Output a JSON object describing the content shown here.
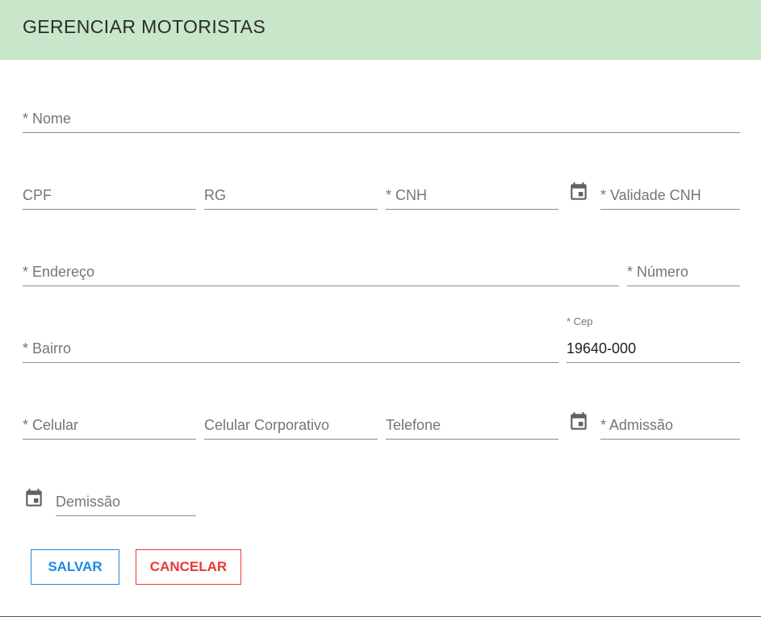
{
  "header": {
    "title": "GERENCIAR MOTORISTAS"
  },
  "form": {
    "nome": {
      "placeholder": "* Nome",
      "value": ""
    },
    "cpf": {
      "placeholder": "CPF",
      "value": ""
    },
    "rg": {
      "placeholder": "RG",
      "value": ""
    },
    "cnh": {
      "placeholder": "* CNH",
      "value": ""
    },
    "validade_cnh": {
      "placeholder": "* Validade CNH",
      "value": "",
      "icon": "calendar-icon"
    },
    "endereco": {
      "placeholder": "* Endereço",
      "value": ""
    },
    "numero": {
      "placeholder": "* Número",
      "value": ""
    },
    "bairro": {
      "placeholder": "* Bairro",
      "value": ""
    },
    "cep": {
      "label": "* Cep",
      "value": "19640-000"
    },
    "celular": {
      "placeholder": "* Celular",
      "value": ""
    },
    "celular_corporativo": {
      "placeholder": "Celular Corporativo",
      "value": ""
    },
    "telefone": {
      "placeholder": "Telefone",
      "value": ""
    },
    "admissao": {
      "placeholder": "* Admissão",
      "value": "",
      "icon": "calendar-icon"
    },
    "demissao": {
      "placeholder": "Demissão",
      "value": "",
      "icon": "calendar-icon"
    }
  },
  "actions": {
    "save_label": "SALVAR",
    "cancel_label": "CANCELAR"
  },
  "colors": {
    "header_bg": "#c8e6c9",
    "save": "#1e88e5",
    "cancel": "#e53935",
    "icon": "#616161"
  }
}
